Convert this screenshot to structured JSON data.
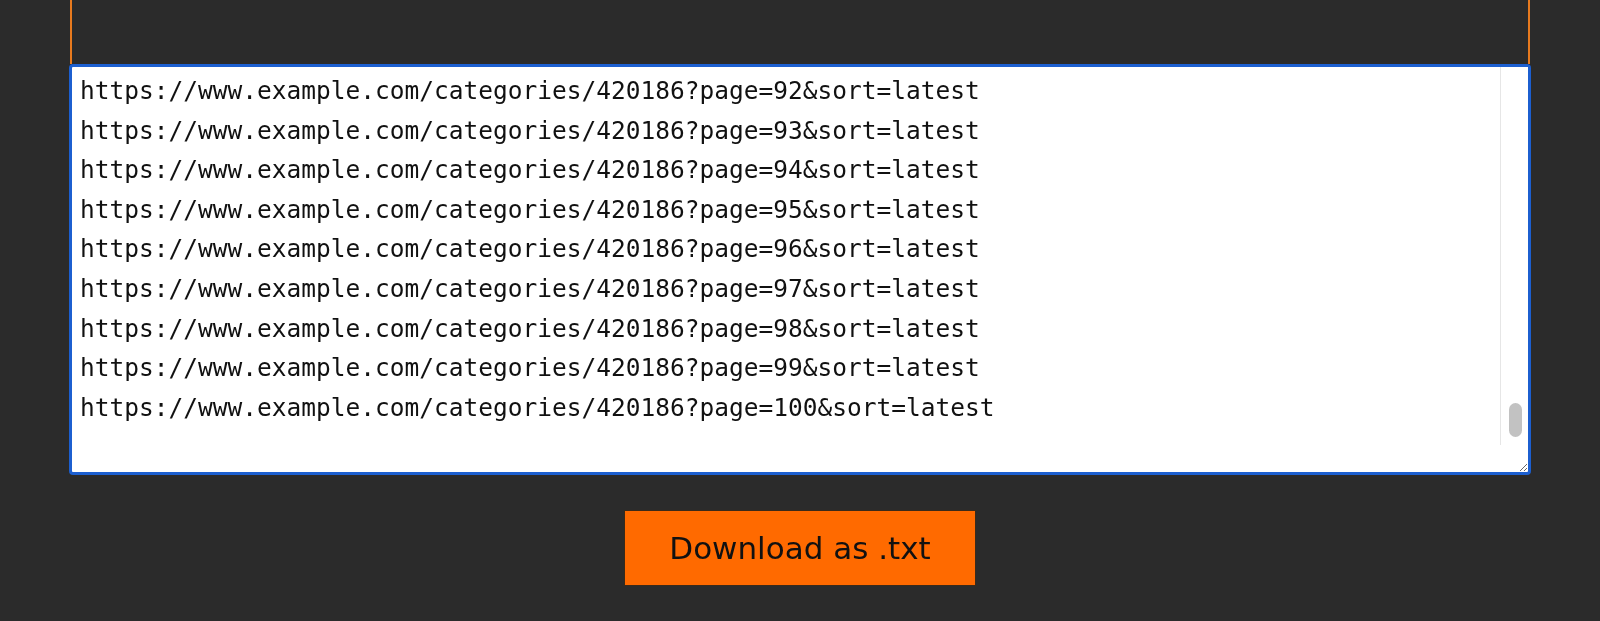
{
  "url_list": {
    "lines": [
      "https://www.example.com/categories/420186?page=92&sort=latest",
      "https://www.example.com/categories/420186?page=93&sort=latest",
      "https://www.example.com/categories/420186?page=94&sort=latest",
      "https://www.example.com/categories/420186?page=95&sort=latest",
      "https://www.example.com/categories/420186?page=96&sort=latest",
      "https://www.example.com/categories/420186?page=97&sort=latest",
      "https://www.example.com/categories/420186?page=98&sort=latest",
      "https://www.example.com/categories/420186?page=99&sort=latest",
      "https://www.example.com/categories/420186?page=100&sort=latest"
    ]
  },
  "download_button": {
    "label": "Download as .txt"
  }
}
